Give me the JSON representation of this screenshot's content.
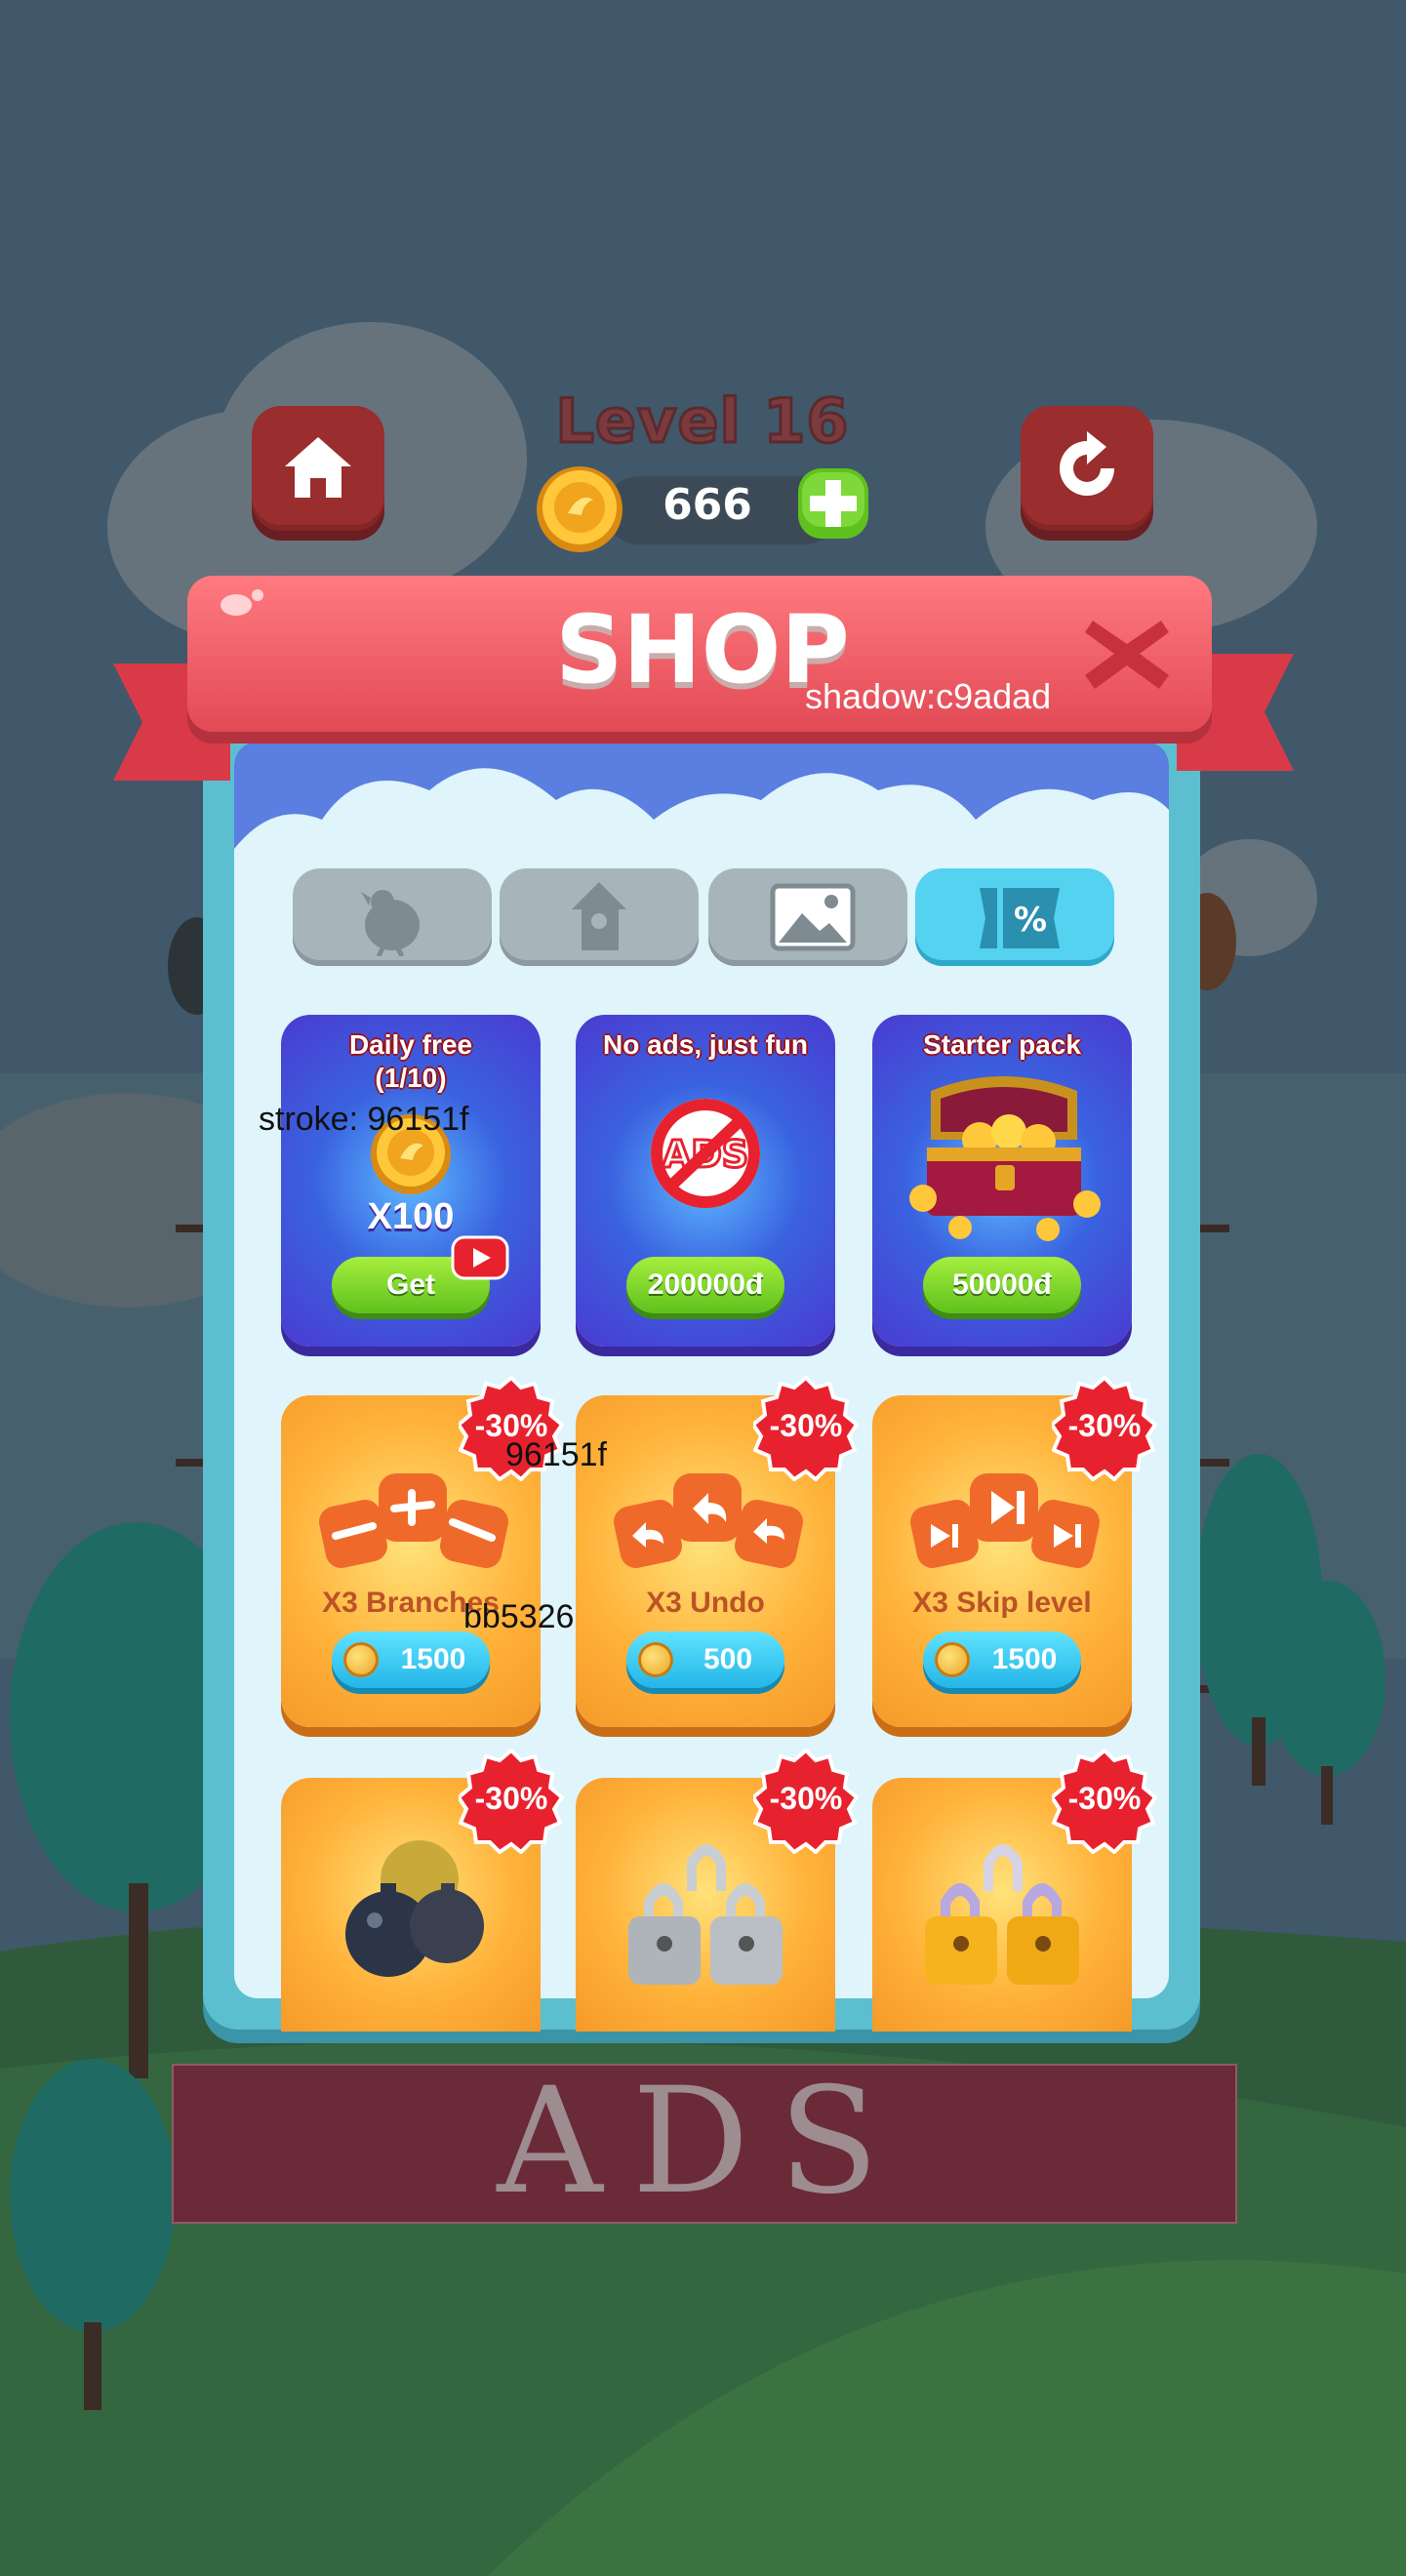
{
  "header": {
    "level_title": "Level 16",
    "coin_count": "666"
  },
  "shop": {
    "title": "SHOP",
    "shadow_note": "shadow:c9adad",
    "tabs": [
      {
        "icon": "bird-icon",
        "active": false
      },
      {
        "icon": "birdhouse-icon",
        "active": false
      },
      {
        "icon": "picture-icon",
        "active": false
      },
      {
        "icon": "discount-ticket-icon",
        "active": true
      }
    ],
    "offers": [
      {
        "title_line1": "Daily free",
        "title_line2": "(1/10)",
        "reward": "X100",
        "button": "Get"
      },
      {
        "title_line1": "No ads, just fun",
        "button": "200000đ"
      },
      {
        "title_line1": "Starter pack",
        "button": "50000đ"
      }
    ],
    "boosters": [
      {
        "name": "X3 Branches",
        "price": "1500",
        "badge": "-30%"
      },
      {
        "name": "X3 Undo",
        "price": "500",
        "badge": "-30%"
      },
      {
        "name": "X3 Skip level",
        "price": "1500",
        "badge": "-30%"
      }
    ],
    "more_boosters": [
      {
        "badge": "-30%",
        "icon": "bomb-icon"
      },
      {
        "badge": "-30%",
        "icon": "silver-lock-icon"
      },
      {
        "badge": "-30%",
        "icon": "gold-lock-icon"
      }
    ],
    "annotations": {
      "stroke": "stroke: 96151f",
      "badge_color": "96151f",
      "name_color": "bb5326"
    }
  },
  "ad": {
    "text": "ADS"
  },
  "colors": {
    "modal_frame": "#5bbfd0",
    "banner_red": "#e24a55",
    "active_tab": "#54d2ef",
    "green_button": "#5fc11d",
    "badge_red": "#e8212e"
  }
}
